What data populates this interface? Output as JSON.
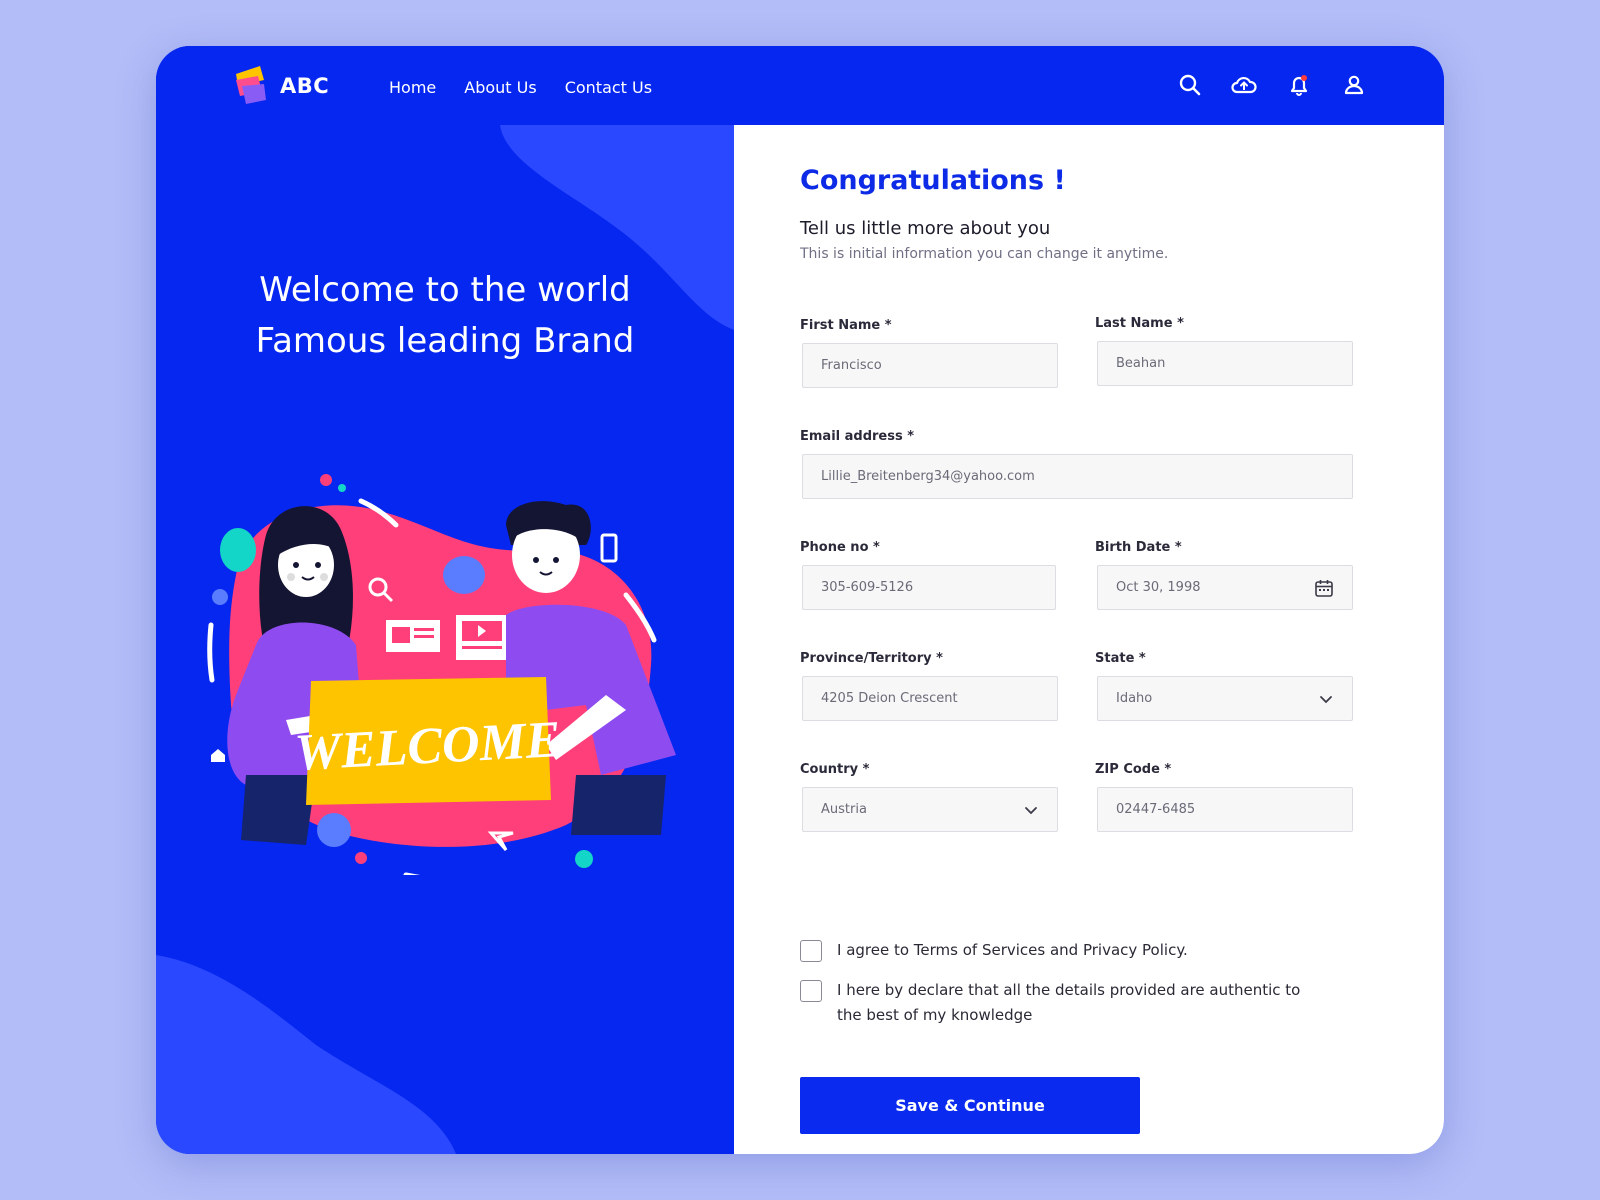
{
  "header": {
    "brand": "ABC",
    "nav": [
      "Home",
      "About Us",
      "Contact Us"
    ],
    "icons": [
      "search-icon",
      "cloud-upload-icon",
      "bell-icon",
      "user-icon"
    ]
  },
  "left": {
    "headline_line1": "Welcome to the world",
    "headline_line2": "Famous leading Brand",
    "banner_text": "WELCOME"
  },
  "form": {
    "title": "Congratulations !",
    "subtitle": "Tell us little more about you",
    "description": "This is initial information you can change it anytime.",
    "first_name": {
      "label": "First Name *",
      "value": "Francisco"
    },
    "last_name": {
      "label": "Last Name *",
      "value": "Beahan"
    },
    "email": {
      "label": "Email address *",
      "value": "Lillie_Breitenberg34@yahoo.com"
    },
    "phone": {
      "label": "Phone no *",
      "value": "305-609-5126"
    },
    "birth_date": {
      "label": "Birth Date *",
      "value": "Oct 30, 1998"
    },
    "province": {
      "label": "Province/Territory *",
      "value": "4205 Deion Crescent"
    },
    "state": {
      "label": "State *",
      "value": "Idaho"
    },
    "country": {
      "label": "Country *",
      "value": "Austria"
    },
    "zip": {
      "label": "ZIP Code *",
      "value": "02447-6485"
    },
    "agree_terms": "I agree to Terms of Services and Privacy Policy.",
    "declare": "I here by declare that all the details provided are authentic to the best of my knowledge",
    "submit": "Save & Continue"
  },
  "colors": {
    "primary": "#0527ef",
    "accent_title": "#0d2be6",
    "page_bg": "#b3bdf7"
  }
}
